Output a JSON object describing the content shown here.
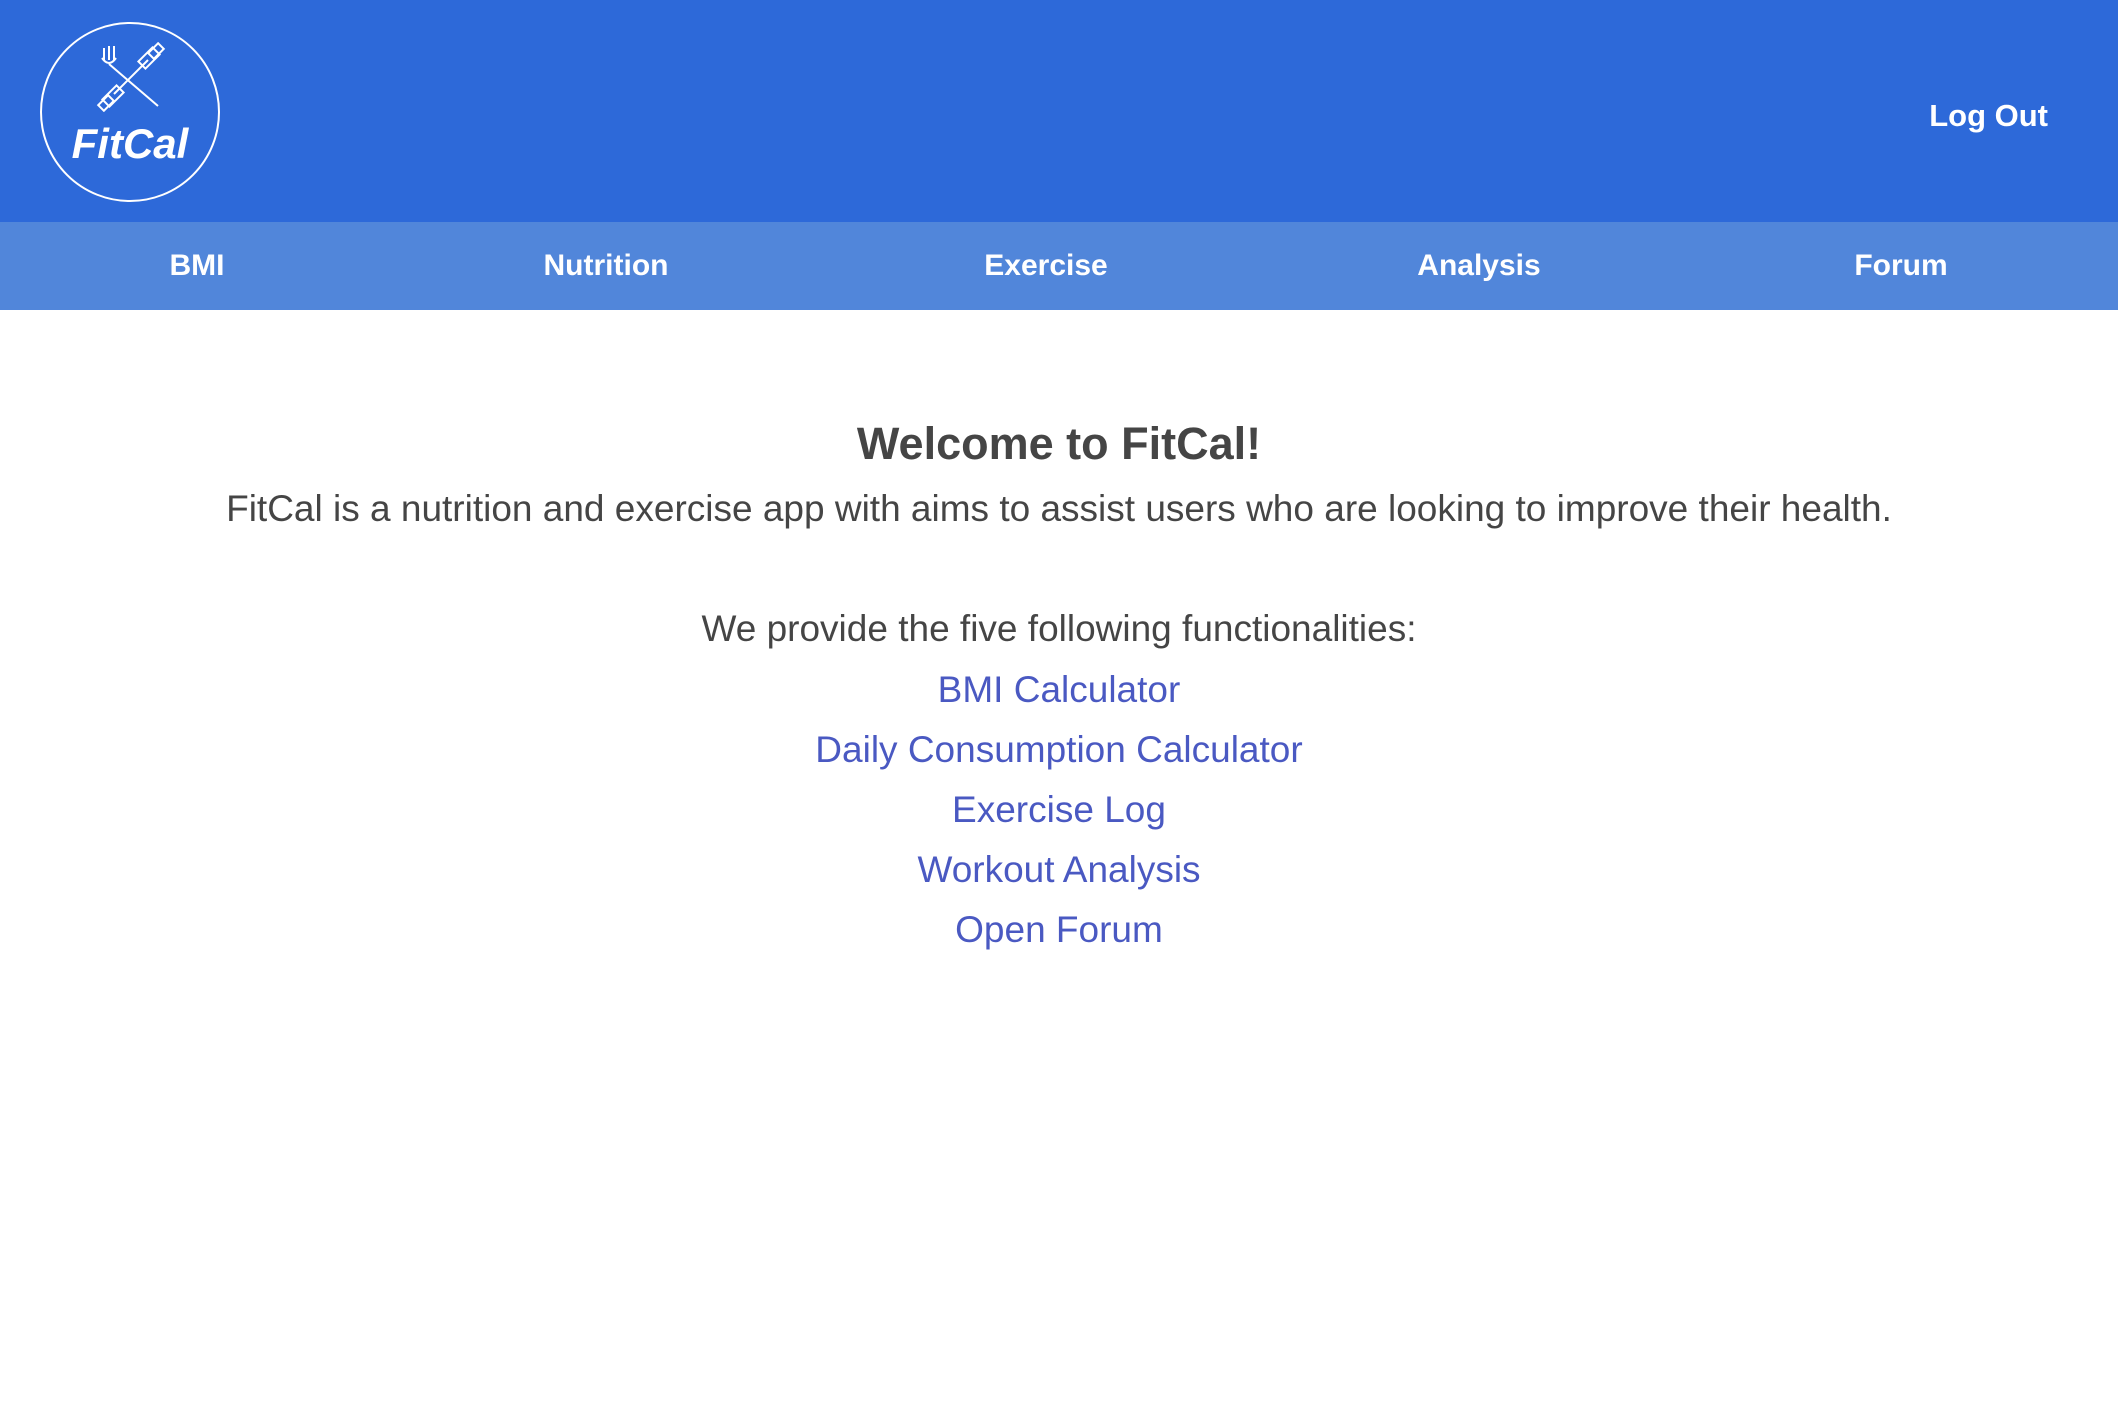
{
  "header": {
    "logo_text": "FitCal",
    "logout_label": "Log Out",
    "background_color": "#2d69d9"
  },
  "nav": {
    "background_color": "#5186da",
    "items": [
      {
        "label": "BMI"
      },
      {
        "label": "Nutrition"
      },
      {
        "label": "Exercise"
      },
      {
        "label": "Analysis"
      },
      {
        "label": "Forum"
      }
    ]
  },
  "main": {
    "title": "Welcome to FitCal!",
    "intro": "FitCal is a nutrition and exercise app with aims to assist users who are looking to improve their health.",
    "features_heading": "We provide the five following functionalities:",
    "link_color": "#4a59c2",
    "features": [
      {
        "label": "BMI Calculator"
      },
      {
        "label": "Daily Consumption Calculator"
      },
      {
        "label": "Exercise Log"
      },
      {
        "label": "Workout Analysis"
      },
      {
        "label": "Open Forum"
      }
    ]
  },
  "icons": {
    "logo": "fork-dumbbell-icon"
  }
}
